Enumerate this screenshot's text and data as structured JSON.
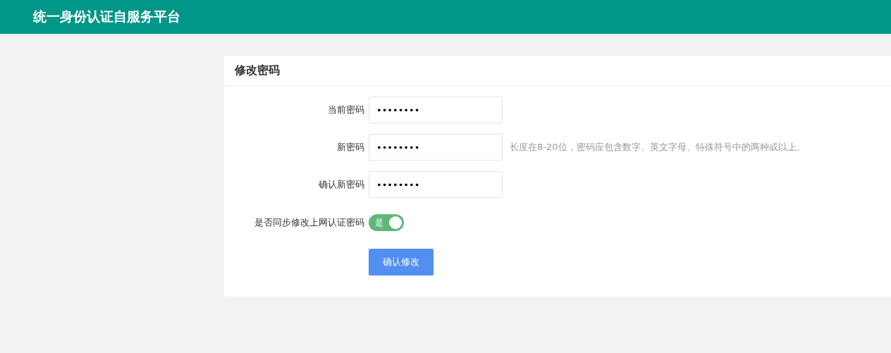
{
  "header": {
    "title": "统一身份认证自服务平台"
  },
  "card": {
    "title": "修改密码",
    "fields": [
      {
        "label": "当前密码",
        "value": "••••••••"
      },
      {
        "label": "新密码",
        "value": "••••••••",
        "hint": "长度在8-20位，密码应包含数字、英文字母、特殊符号中的两种或以上。"
      },
      {
        "label": "确认新密码",
        "value": "••••••••"
      }
    ],
    "sync": {
      "label": "是否同步修改上网认证密码",
      "on": true,
      "text": "是"
    },
    "submit": "确认修改"
  }
}
